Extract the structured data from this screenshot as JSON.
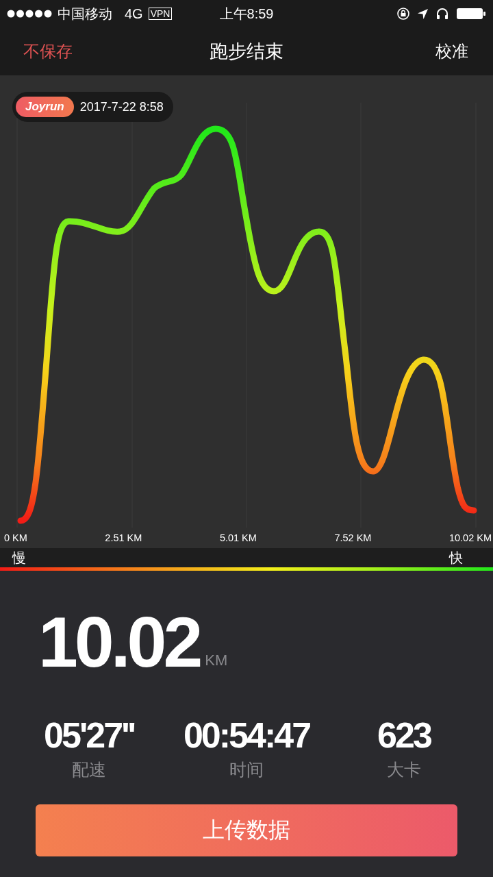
{
  "status_bar": {
    "carrier": "中国移动",
    "network": "4G",
    "vpn": "VPN",
    "time": "上午8:59"
  },
  "nav": {
    "left": "不保存",
    "title": "跑步结束",
    "right": "校准"
  },
  "chart": {
    "badge": {
      "brand": "Joyrun",
      "date": "2017-7-22 8:58"
    },
    "x_labels": [
      "0 KM",
      "2.51 KM",
      "5.01 KM",
      "7.52 KM",
      "10.02 KM"
    ]
  },
  "legend": {
    "slow": "慢",
    "fast": "快"
  },
  "summary": {
    "distance": "10.02",
    "unit": "KM",
    "stats": [
      {
        "value": "05'27''",
        "label": "配速"
      },
      {
        "value": "00:54:47",
        "label": "时间"
      },
      {
        "value": "623",
        "label": "大卡"
      }
    ]
  },
  "button": "上传数据"
}
